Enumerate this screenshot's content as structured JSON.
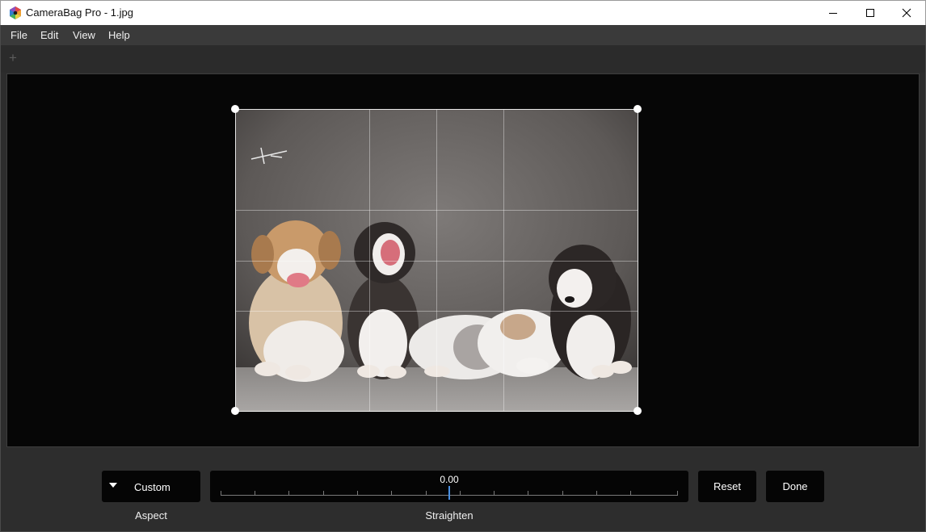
{
  "window": {
    "title": "CameraBag Pro - 1.jpg",
    "app_icon": "camerabag-logo-icon",
    "controls": [
      "minimize-icon",
      "maximize-icon",
      "close-icon"
    ]
  },
  "menu": {
    "items": [
      "File",
      "Edit",
      "View",
      "Help"
    ]
  },
  "toolbar": {
    "add_icon": "plus-icon"
  },
  "canvas": {
    "image_description": "photo-of-puppies",
    "crop_overlay_visible": true
  },
  "controls": {
    "aspect": {
      "value": "Custom",
      "caption": "Aspect",
      "dropdown_icon": "triangle-down-icon"
    },
    "straighten": {
      "value": "0.00",
      "caption": "Straighten",
      "position_fraction": 0.5,
      "accent_color": "#4a90e2"
    },
    "reset_label": "Reset",
    "done_label": "Done"
  }
}
